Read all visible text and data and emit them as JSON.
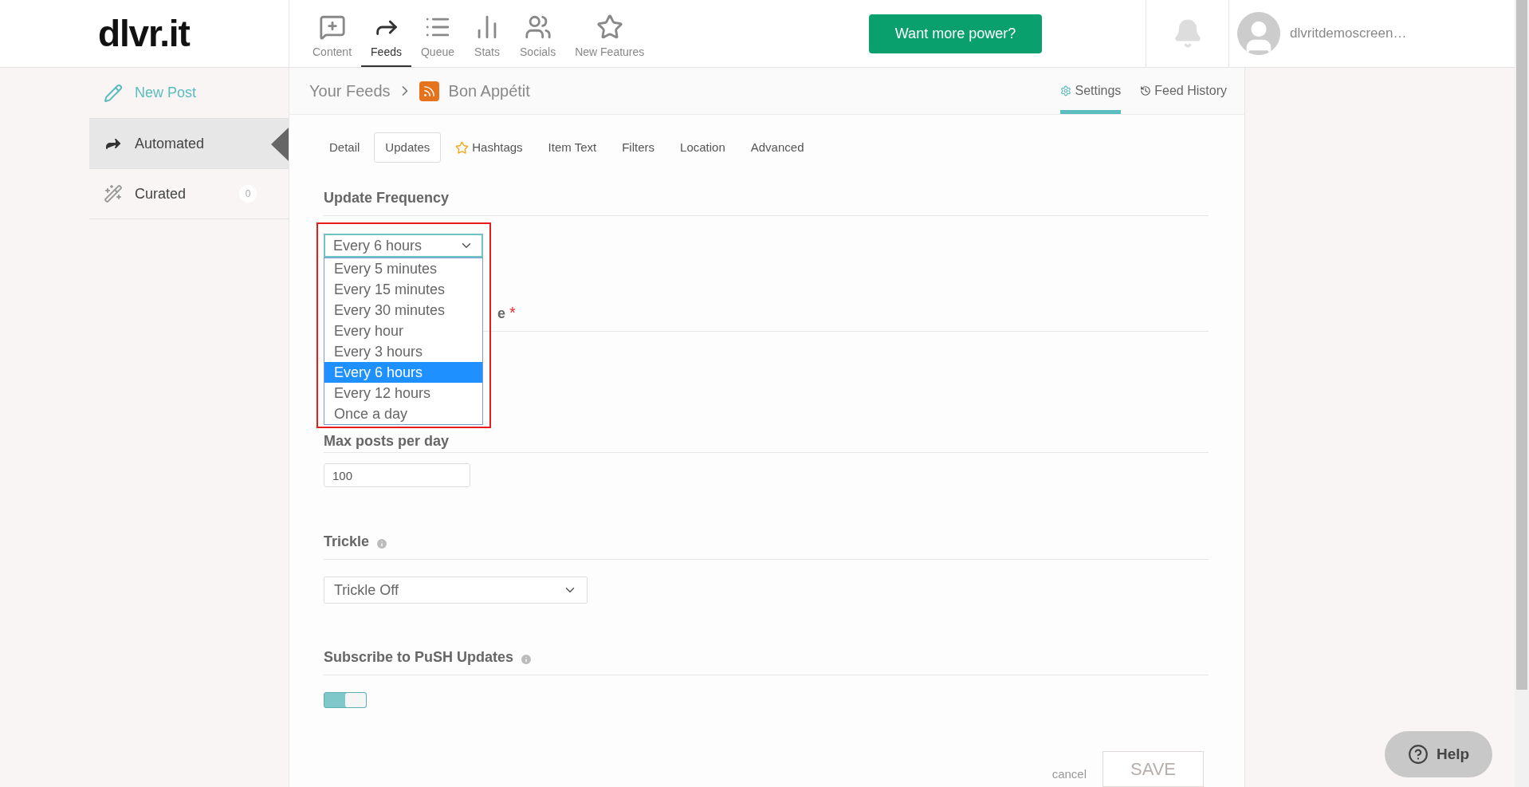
{
  "logo": "dlvr.it",
  "nav": [
    {
      "label": "Content",
      "kind": "content",
      "selected": false
    },
    {
      "label": "Feeds",
      "kind": "feeds",
      "selected": true
    },
    {
      "label": "Queue",
      "kind": "queue",
      "selected": false
    },
    {
      "label": "Stats",
      "kind": "stats",
      "selected": false
    },
    {
      "label": "Socials",
      "kind": "socials",
      "selected": false
    },
    {
      "label": "New Features",
      "kind": "features",
      "selected": false
    }
  ],
  "upgrade_button": "Want more power?",
  "account": {
    "name": "dlvritdemoscreen…"
  },
  "sidebar": {
    "items": [
      {
        "label": "New Post",
        "kind": "new",
        "selected": false
      },
      {
        "label": "Automated",
        "kind": "automated",
        "selected": true
      },
      {
        "label": "Curated",
        "kind": "curated",
        "selected": false,
        "count": "0"
      }
    ]
  },
  "breadcrumb": {
    "root": "Your Feeds",
    "feed": "Bon Appétit"
  },
  "header_tabs": [
    {
      "label": "Settings",
      "kind": "settings",
      "selected": true
    },
    {
      "label": "Feed History",
      "kind": "history",
      "selected": false
    }
  ],
  "tabs": [
    {
      "label": "Detail",
      "kind": "plain",
      "selected": false
    },
    {
      "label": "Updates",
      "kind": "plain",
      "selected": true
    },
    {
      "label": "Hashtags",
      "kind": "starred",
      "selected": false
    },
    {
      "label": "Item Text",
      "kind": "plain",
      "selected": false
    },
    {
      "label": "Filters",
      "kind": "plain",
      "selected": false
    },
    {
      "label": "Location",
      "kind": "plain",
      "selected": false
    },
    {
      "label": "Advanced",
      "kind": "plain",
      "selected": false
    }
  ],
  "update_frequency": {
    "title": "Update Frequency",
    "highlighted": true,
    "select": {
      "value": "Every 6 hours",
      "open": true,
      "options": [
        {
          "label": "Every 5 minutes",
          "selected": false
        },
        {
          "label": "Every 15 minutes",
          "selected": false
        },
        {
          "label": "Every 30 minutes",
          "selected": false
        },
        {
          "label": "Every hour",
          "selected": false
        },
        {
          "label": "Every 3 hours",
          "selected": false
        },
        {
          "label": "Every 6 hours",
          "selected": true
        },
        {
          "label": "Every 12 hours",
          "selected": false
        },
        {
          "label": "Once a day",
          "selected": false
        }
      ]
    }
  },
  "covered_section": {
    "title": "e",
    "required": true,
    "required_mark": "*"
  },
  "max_posts": {
    "title": "Max posts per day",
    "value": "100"
  },
  "trickle": {
    "title": "Trickle",
    "info": true,
    "select": {
      "value": "Trickle Off"
    }
  },
  "push": {
    "title": "Subscribe to PuSH Updates",
    "info": true,
    "toggle": {
      "on": true
    }
  },
  "footer": {
    "cancel": "cancel",
    "save": {
      "label": "SAVE",
      "disabled": true
    }
  },
  "help_button": "Help"
}
